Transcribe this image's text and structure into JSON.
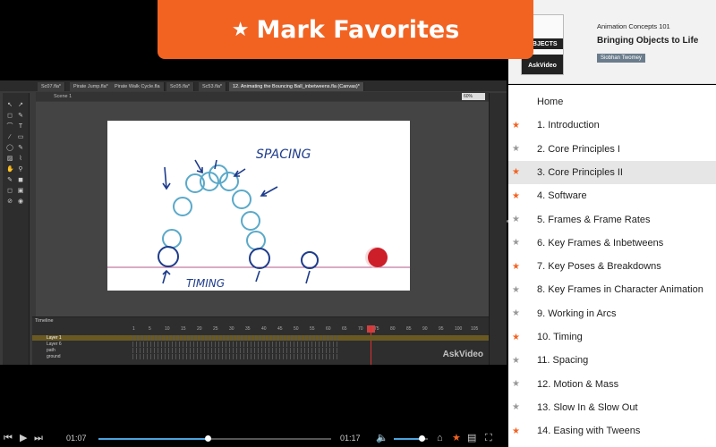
{
  "banner": {
    "label": "Mark Favorites"
  },
  "course": {
    "series": "Animation Concepts 101",
    "title": "Bringing Objects to Life",
    "author": "Siobhan Twomey",
    "thumb_title": "OBJECTS",
    "thumb_brand": "AskVideo"
  },
  "app": {
    "tabs": [
      "Sc07.fla*",
      "Pirate Jump.fla*",
      "Pirate Walk Cycle.fla",
      "Sc05.fla*",
      "Sc53.fla*",
      "12. Animating the Bouncing Ball_inbetweens.fla (Canvas)*"
    ],
    "scene": "Scene 1",
    "zoom": "60%",
    "timeline_label": "Timeline",
    "layers": [
      "Layer 1",
      "Layer 6",
      "path",
      "ground"
    ],
    "frame_numbers": [
      "1",
      "5",
      "10",
      "15",
      "20",
      "25",
      "30",
      "35",
      "40",
      "45",
      "50",
      "55",
      "60",
      "65",
      "70",
      "75",
      "80",
      "85",
      "90",
      "95",
      "100",
      "105"
    ],
    "current_frame": "64",
    "watermark": "AskVideo",
    "stage": {
      "spacing_text": "SPACING",
      "timing_text": "TIMING"
    }
  },
  "chapters": [
    {
      "label": "Home",
      "starred": null
    },
    {
      "label": "1. Introduction",
      "starred": true
    },
    {
      "label": "2. Core Principles I",
      "starred": false
    },
    {
      "label": "3. Core Principles II",
      "starred": true,
      "active": true
    },
    {
      "label": "4. Software",
      "starred": true
    },
    {
      "label": "5. Frames & Frame Rates",
      "starred": false
    },
    {
      "label": "6. Key Frames & Inbetweens",
      "starred": false
    },
    {
      "label": "7. Key Poses & Breakdowns",
      "starred": true
    },
    {
      "label": "8. Key Frames in Character Animation",
      "starred": false
    },
    {
      "label": "9. Working in Arcs",
      "starred": false
    },
    {
      "label": "10. Timing",
      "starred": true
    },
    {
      "label": "11. Spacing",
      "starred": false
    },
    {
      "label": "12. Motion & Mass",
      "starred": false
    },
    {
      "label": "13. Slow In & Slow Out",
      "starred": false
    },
    {
      "label": "14. Easing with Tweens",
      "starred": true
    }
  ],
  "player": {
    "time_current": "01:07",
    "time_total": "01:17",
    "progress": 0.47,
    "volume": 0.82
  },
  "colors": {
    "accent": "#f26322",
    "star_on": "#f26322",
    "star_off": "#999999",
    "progress": "#4aa3df"
  },
  "icons": [
    "star-icon",
    "skip-back-icon",
    "play-icon",
    "skip-forward-icon",
    "volume-icon",
    "home-icon",
    "favorite-icon",
    "notes-icon",
    "fullscreen-icon"
  ]
}
